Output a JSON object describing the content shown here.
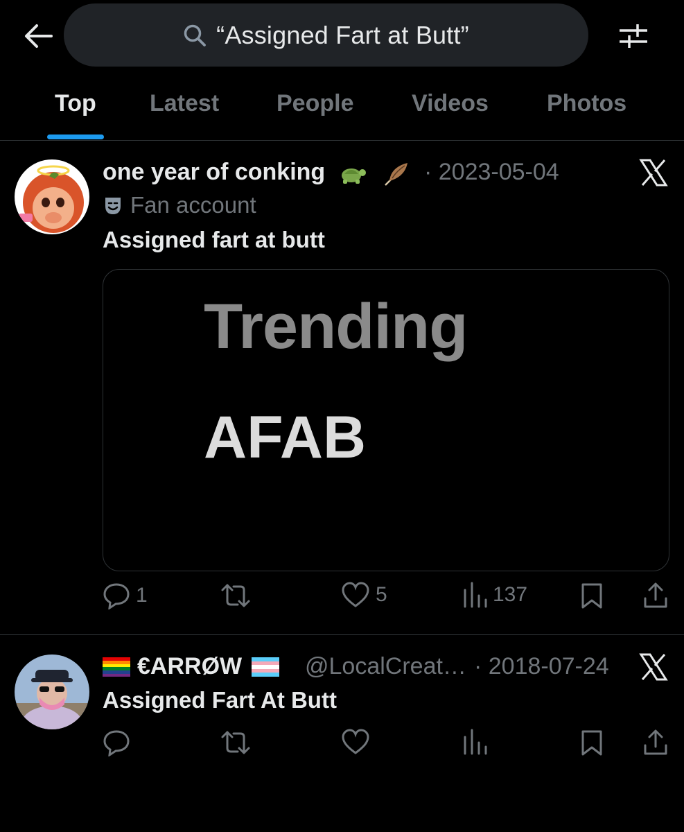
{
  "header": {
    "search_query": "“Assigned Fart at Butt”"
  },
  "tabs": [
    {
      "label": "Top",
      "active": true
    },
    {
      "label": "Latest",
      "active": false
    },
    {
      "label": "People",
      "active": false
    },
    {
      "label": "Videos",
      "active": false
    },
    {
      "label": "Photos",
      "active": false
    }
  ],
  "tweets": [
    {
      "display_name": "one year of conking",
      "name_emojis": [
        "turtle-icon",
        "feather-icon"
      ],
      "date": "· 2023-05-04",
      "label": "Fan account",
      "label_icon": "theater-masks-icon",
      "text": "Assigned fart at butt",
      "media": {
        "title": "Trending",
        "subtitle": "AFAB"
      },
      "stats": {
        "replies": "1",
        "reposts": "",
        "likes": "5",
        "views": "137"
      }
    },
    {
      "display_name": "€ARRØW",
      "name_emojis": [
        "rainbow-flag-icon",
        "transgender-flag-icon"
      ],
      "handle": "@LocalCreat…",
      "date": "· 2018-07-24",
      "text": "Assigned Fart At Butt",
      "stats": {
        "replies": "",
        "reposts": "",
        "likes": "",
        "views": ""
      }
    }
  ],
  "colors": {
    "background": "#000000",
    "text_primary": "#e7e9ea",
    "text_secondary": "#71767b",
    "accent": "#1d9bf0",
    "divider": "#2f3336",
    "search_bg": "#202327"
  }
}
